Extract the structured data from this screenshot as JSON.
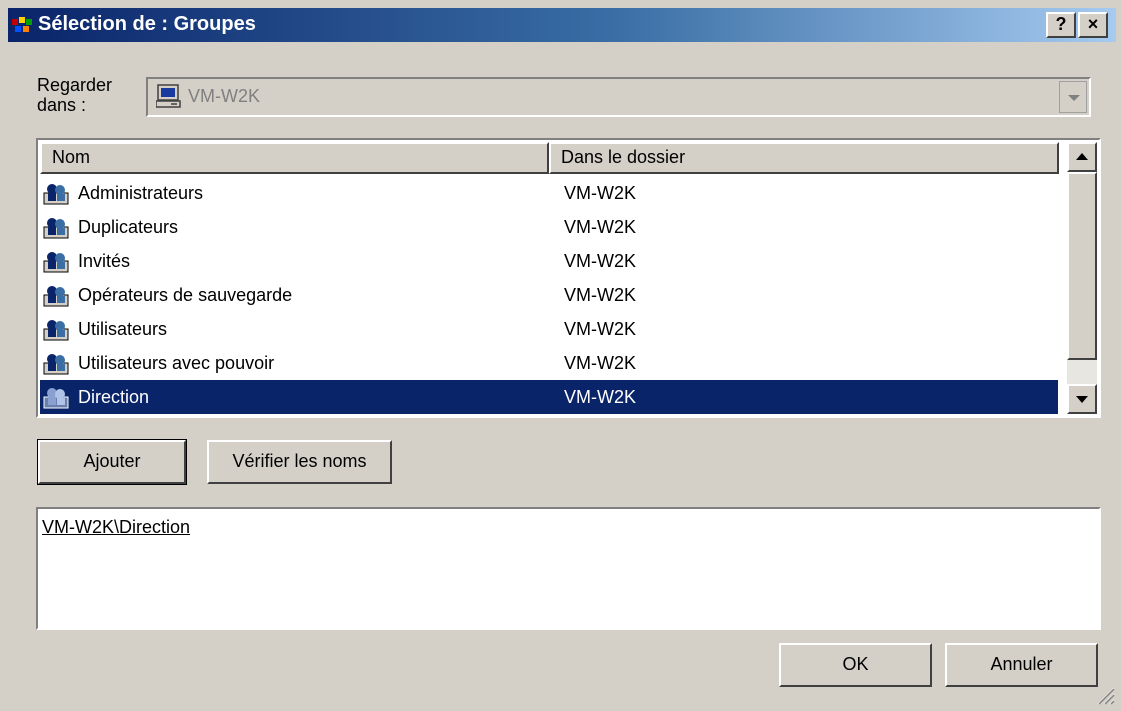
{
  "window": {
    "title": "Sélection de : Groupes",
    "help_label": "?",
    "close_label": "×"
  },
  "look_in": {
    "label_line1": "Regarder",
    "label_line2": "dans :",
    "value": "VM-W2K"
  },
  "list": {
    "columns": [
      "Nom",
      "Dans le dossier"
    ],
    "rows": [
      {
        "name": "Administrateurs",
        "folder": "VM-W2K",
        "selected": false
      },
      {
        "name": "Duplicateurs",
        "folder": "VM-W2K",
        "selected": false
      },
      {
        "name": "Invités",
        "folder": "VM-W2K",
        "selected": false
      },
      {
        "name": "Opérateurs de sauvegarde",
        "folder": "VM-W2K",
        "selected": false
      },
      {
        "name": "Utilisateurs",
        "folder": "VM-W2K",
        "selected": false
      },
      {
        "name": "Utilisateurs avec pouvoir",
        "folder": "VM-W2K",
        "selected": false
      },
      {
        "name": "Direction",
        "folder": "VM-W2K",
        "selected": true
      }
    ]
  },
  "buttons": {
    "add": "Ajouter",
    "check_names": "Vérifier les noms",
    "ok": "OK",
    "cancel": "Annuler"
  },
  "selected_text": "VM-W2K\\Direction",
  "colors": {
    "selection": "#0a246a",
    "face": "#d4d0c8"
  }
}
